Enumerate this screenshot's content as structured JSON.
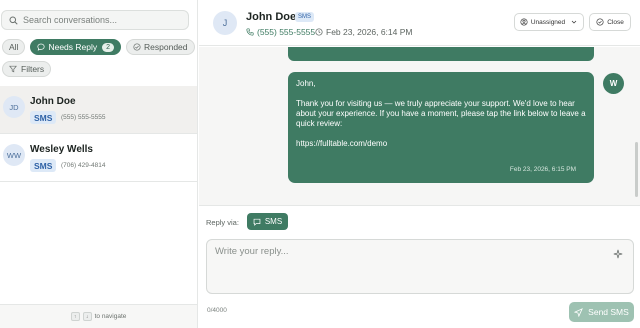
{
  "search": {
    "placeholder": "Search conversations..."
  },
  "filters": {
    "all": "All",
    "needs_reply": "Needs Reply",
    "needs_reply_count": "2",
    "responded": "Responded",
    "filters_button": "Filters"
  },
  "conversations": [
    {
      "initials": "JD",
      "name": "John Doe",
      "channel": "SMS",
      "phone": "(555) 555-5555"
    },
    {
      "initials": "WW",
      "name": "Wesley Wells",
      "channel": "SMS",
      "phone": "(706) 429-4814"
    }
  ],
  "nav_hint": {
    "up": "↑",
    "down": "↓",
    "label": "to navigate"
  },
  "header": {
    "initial": "J",
    "name": "John Doe",
    "channel_badge": "SMS",
    "phone": "(555) 555-5555",
    "timestamp": "Feb 23, 2026, 6:14 PM",
    "assign_label": "Unassigned",
    "close_label": "Close"
  },
  "message": {
    "greeting": "John,",
    "body": "Thank you for visiting us — we truly appreciate your support. We'd love to hear about your experience. If you have a moment, please tap the link below to leave a quick review:",
    "link": "https://fulltable.com/demo",
    "time": "Feb 23, 2026, 6:15 PM",
    "sender_initial": "W"
  },
  "composer": {
    "reply_via": "Reply via:",
    "channel": "SMS",
    "placeholder": "Write your reply...",
    "char_count": "0/4000",
    "send_label": "Send SMS"
  },
  "colors": {
    "accent": "#3f7b63",
    "accent_disabled": "#9ec2b2",
    "badge_bg": "#dde9f7",
    "badge_text": "#2f62a6"
  }
}
